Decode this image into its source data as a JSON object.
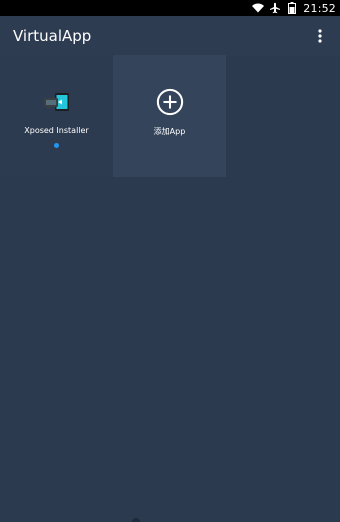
{
  "status_bar": {
    "time": "21:52",
    "icons": [
      "wifi-icon",
      "airplane-icon",
      "battery-icon"
    ]
  },
  "app_bar": {
    "title": "VirtualApp",
    "menu_icon": "overflow-menu-icon"
  },
  "apps": [
    {
      "label": "Xposed Installer",
      "icon": "xposed-installer-icon",
      "has_indicator": true
    },
    {
      "label": "添加App",
      "icon": "add-circle-icon",
      "has_indicator": false
    }
  ],
  "colors": {
    "background": "#2c3a4f",
    "app_bar": "#2e3c52",
    "tile_selected": "#34445b",
    "indicator": "#2196f3"
  }
}
